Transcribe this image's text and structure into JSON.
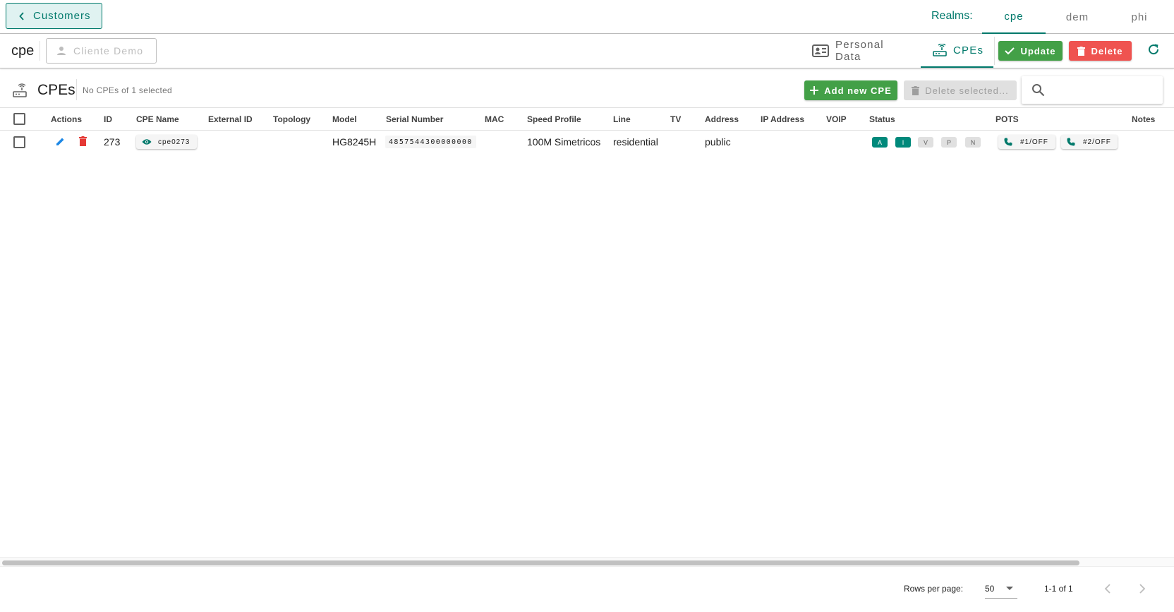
{
  "topbar": {
    "back_label": "Customers",
    "realms_label": "Realms:",
    "realms": [
      "cpe",
      "dem",
      "phi"
    ],
    "active_realm": "cpe"
  },
  "customer_bar": {
    "realm_name": "cpe",
    "customer_placeholder": "Cliente Demo",
    "tabs": [
      {
        "label": "Personal Data",
        "icon": "id-card-icon"
      },
      {
        "label": "CPEs",
        "icon": "router-icon"
      }
    ],
    "active_tab": "CPEs",
    "update_label": "Update",
    "delete_label": "Delete"
  },
  "cpe_toolbar": {
    "title": "CPEs",
    "selection_text": "No CPEs of 1 selected",
    "add_label": "Add new CPE",
    "delete_selected_label": "Delete selected...",
    "search_value": ""
  },
  "table": {
    "columns": [
      "Actions",
      "ID",
      "CPE Name",
      "External ID",
      "Topology",
      "Model",
      "Serial Number",
      "MAC",
      "Speed Profile",
      "Line",
      "TV",
      "Address",
      "IP Address",
      "VOIP",
      "Status",
      "POTS",
      "Notes"
    ],
    "rows": [
      {
        "id": "273",
        "cpe_name": "cpe0273",
        "external_id": "",
        "topology": "",
        "model": "HG8245H",
        "serial": "4857544300000000",
        "mac": "",
        "speed_profile": "100M Simetricos",
        "line": "residential",
        "tv": "",
        "address": "public",
        "ip_address": "",
        "voip": "",
        "status": [
          {
            "label": "A",
            "on": true
          },
          {
            "label": "I",
            "on": true
          },
          {
            "label": "V",
            "on": false
          },
          {
            "label": "P",
            "on": false
          },
          {
            "label": "N",
            "on": false
          }
        ],
        "pots": [
          "#1/OFF",
          "#2/OFF"
        ],
        "notes": ""
      }
    ]
  },
  "footer": {
    "rows_per_page_label": "Rows per page:",
    "rows_per_page": "50",
    "range": "1-1 of 1"
  },
  "colors": {
    "primary": "#00796b",
    "success": "#43a047",
    "danger": "#ef5350",
    "edit": "#1e88e5",
    "status_on": "#00897b"
  }
}
